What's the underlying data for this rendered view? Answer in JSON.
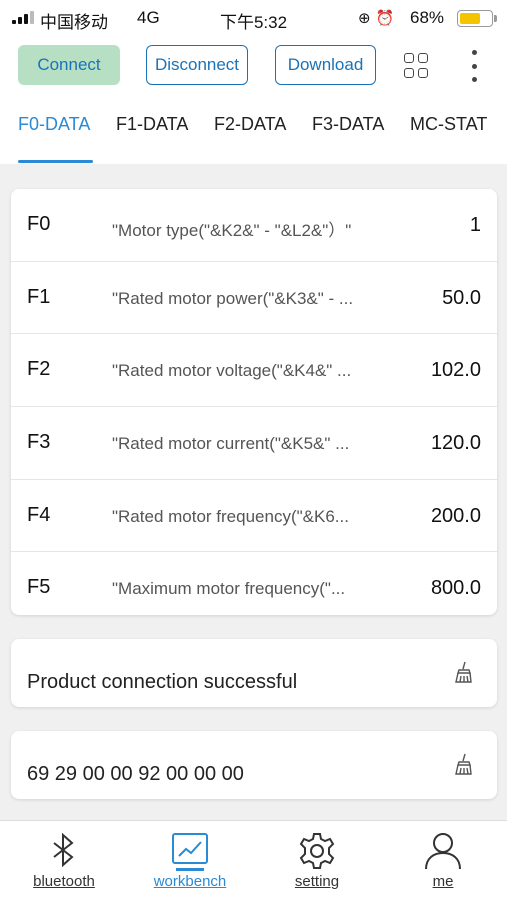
{
  "status_bar": {
    "carrier": "中国移动",
    "network": "4G",
    "time": "下午5:32",
    "battery": "68%",
    "battery_level": 0.68
  },
  "toolbar": {
    "connect_label": "Connect",
    "disconnect_label": "Disconnect",
    "download_label": "Download",
    "grid_icon": "grid-icon",
    "more_icon": "more-vertical-icon"
  },
  "tabs": [
    {
      "label": "F0-DATA",
      "active": true
    },
    {
      "label": "F1-DATA",
      "active": false
    },
    {
      "label": "F2-DATA",
      "active": false
    },
    {
      "label": "F3-DATA",
      "active": false
    },
    {
      "label": "MC-STAT",
      "active": false
    }
  ],
  "params": [
    {
      "code": "F0",
      "desc": "\"Motor type(\"&K2&\" - \"&L2&\"）\"",
      "value": "1"
    },
    {
      "code": "F1",
      "desc": "\"Rated motor power(\"&K3&\" - ...",
      "value": "50.0"
    },
    {
      "code": "F2",
      "desc": "\"Rated motor voltage(\"&K4&\" ...",
      "value": "102.0"
    },
    {
      "code": "F3",
      "desc": "\"Rated motor current(\"&K5&\" ...",
      "value": "120.0"
    },
    {
      "code": "F4",
      "desc": "\"Rated motor frequency(\"&K6...",
      "value": "200.0"
    },
    {
      "code": "F5",
      "desc": "\"Maximum motor frequency(\"...",
      "value": "800.0"
    }
  ],
  "messages": {
    "status": "Product connection successful",
    "hex": "69 29 00 00 92 00 00 00"
  },
  "bottom_nav": [
    {
      "label": "bluetooth",
      "icon": "bluetooth-icon",
      "active": false
    },
    {
      "label": "workbench",
      "icon": "workbench-chart-icon",
      "active": true
    },
    {
      "label": "setting",
      "icon": "gear-icon",
      "active": false
    },
    {
      "label": "me",
      "icon": "person-icon",
      "active": false
    }
  ],
  "colors": {
    "accent": "#2a8ad4",
    "button_text": "#1a73b8",
    "connect_bg": "#b7dfc4",
    "battery": "#f5c400"
  }
}
